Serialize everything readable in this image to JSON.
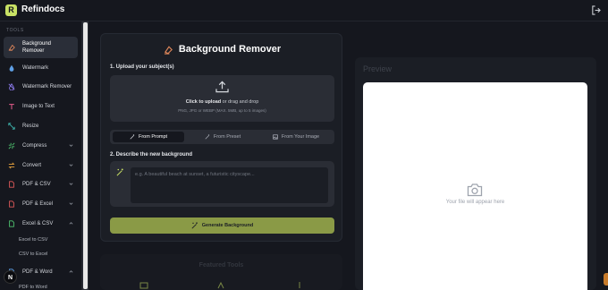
{
  "app": {
    "brand_letter": "R",
    "brand_name": "Refindocs",
    "accent": "#c9e265",
    "button_color": "#8a9a46"
  },
  "sidebar": {
    "section": "TOOLS",
    "items": [
      {
        "label": "Background Remover",
        "icon": "bg-remover-icon",
        "active": true
      },
      {
        "label": "Watermark",
        "icon": "watermark-icon"
      },
      {
        "label": "Watermark Remover",
        "icon": "watermark-remover-icon"
      },
      {
        "label": "Image to Text",
        "icon": "image-to-text-icon"
      },
      {
        "label": "Resize",
        "icon": "resize-icon"
      },
      {
        "label": "Compress",
        "icon": "compress-icon",
        "expandable": true
      },
      {
        "label": "Convert",
        "icon": "convert-icon",
        "expandable": true
      },
      {
        "label": "PDF & CSV",
        "icon": "pdf-csv-icon",
        "expandable": true
      },
      {
        "label": "PDF & Excel",
        "icon": "pdf-excel-icon",
        "expandable": true
      },
      {
        "label": "Excel & CSV",
        "icon": "excel-csv-icon",
        "expandable": true,
        "expanded": true
      },
      {
        "label": "PDF & Word",
        "icon": "pdf-word-icon",
        "expandable": true,
        "expanded": true
      }
    ],
    "subitems": [
      "Excel to CSV",
      "CSV to Excel",
      "PDF to Word"
    ],
    "badge": "N"
  },
  "main": {
    "title": "Background Remover",
    "step1": "1. Upload your subject(s)",
    "upload_click": "Click to upload",
    "upload_rest": " or drag and drop",
    "upload_hint": "PNG, JPG or WEBP (MAX. 5MB, up to 5 images)",
    "tabs": [
      {
        "label": "From Prompt",
        "active": true
      },
      {
        "label": "From Preset"
      },
      {
        "label": "From Your Image"
      }
    ],
    "step2": "2. Describe the new background",
    "prompt_placeholder": "e.g. A beautiful beach at sunset, a futuristic cityscape...",
    "generate_label": "Generate Background",
    "faded_title": "Featured Tools"
  },
  "preview": {
    "title": "Preview",
    "empty_text": "Your file will appear here"
  }
}
